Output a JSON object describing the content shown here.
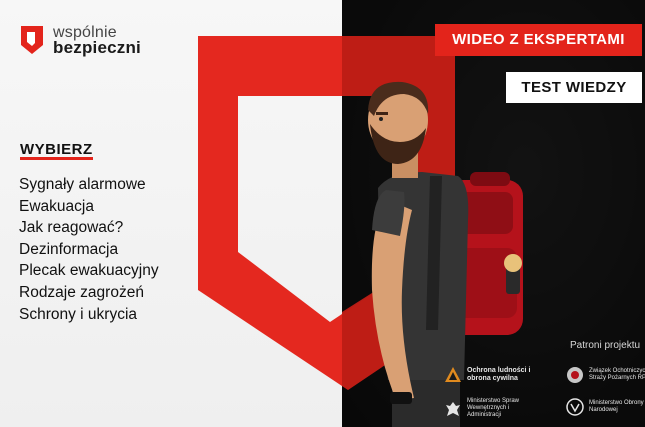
{
  "logo": {
    "line1": "wspólnie",
    "line2": "bezpieczni"
  },
  "menu": {
    "heading": "WYBIERZ",
    "items": [
      {
        "label": "Sygnały alarmowe"
      },
      {
        "label": "Ewakuacja"
      },
      {
        "label": "Jak reagować?"
      },
      {
        "label": "Dezinformacja"
      },
      {
        "label": "Plecak ewakuacyjny"
      },
      {
        "label": "Rodzaje zagrożeń"
      },
      {
        "label": "Schrony i ukrycia"
      }
    ]
  },
  "buttons": {
    "video": "WIDEO Z EKSPERTAMI",
    "quiz": "TEST WIEDZY"
  },
  "patrons": {
    "label": "Patroni projektu",
    "items": [
      {
        "name": "Ochrona ludności i obrona cywilna"
      },
      {
        "name": "Związek Ochotniczych Straży Pożarnych RP"
      },
      {
        "name": "Ministerstwo Spraw Wewnętrznych i Administracji"
      },
      {
        "name": "Ministerstwo Obrony Narodowej"
      }
    ]
  },
  "colors": {
    "accent": "#e3241b",
    "dark": "#0b0b0b",
    "light": "#f4f4f4"
  }
}
